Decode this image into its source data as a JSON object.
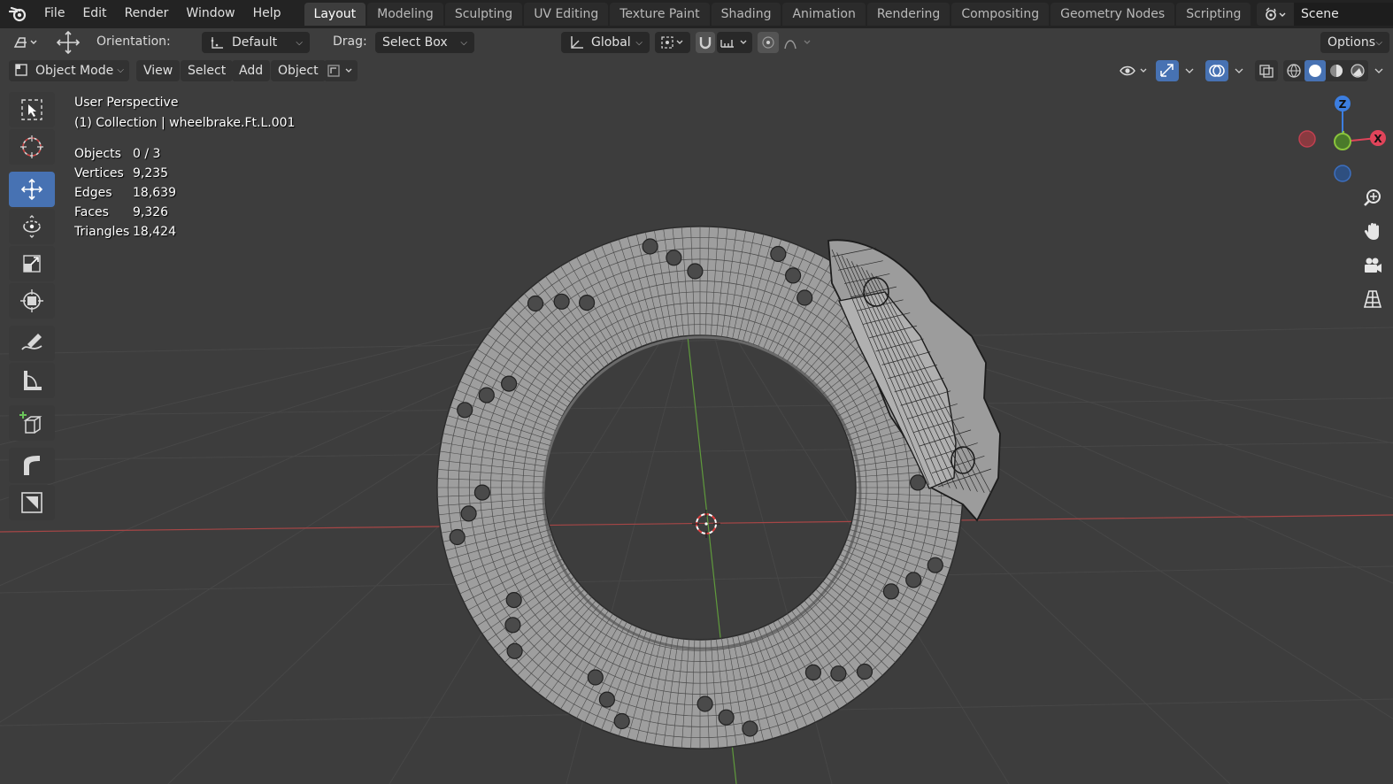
{
  "menu": {
    "items": [
      "File",
      "Edit",
      "Render",
      "Window",
      "Help"
    ]
  },
  "workspaces": {
    "tabs": [
      "Layout",
      "Modeling",
      "Sculpting",
      "UV Editing",
      "Texture Paint",
      "Shading",
      "Animation",
      "Rendering",
      "Compositing",
      "Geometry Nodes",
      "Scripting"
    ],
    "active": "Layout"
  },
  "scene": {
    "name": "Scene"
  },
  "toolheader": {
    "orientation_label": "Orientation:",
    "orientation_value": "Default",
    "drag_label": "Drag:",
    "drag_value": "Select Box",
    "transform_orientation": "Global",
    "options_label": "Options"
  },
  "viewport_header": {
    "mode": "Object Mode",
    "menus": [
      "View",
      "Select",
      "Add",
      "Object"
    ]
  },
  "overlay": {
    "perspective": "User Perspective",
    "collection": "(1) Collection | wheelbrake.Ft.L.001"
  },
  "stats": [
    {
      "label": "Objects",
      "value": "0 / 3"
    },
    {
      "label": "Vertices",
      "value": "9,235"
    },
    {
      "label": "Edges",
      "value": "18,639"
    },
    {
      "label": "Faces",
      "value": "9,326"
    },
    {
      "label": "Triangles",
      "value": "18,424"
    }
  ],
  "gizmo": {
    "z_label": "Z",
    "x_label": "X",
    "colors": {
      "x": "#e0445a",
      "y": "#8ac43c",
      "z": "#3c7ee0"
    }
  },
  "colors": {
    "accent": "#4772b3",
    "viewport_bg": "#3d3d3d",
    "mesh_fill": "#9c9c9c",
    "grid_x_axis": "#b04a4a",
    "grid_y_axis": "#6aa34a"
  },
  "toolbar_icons": [
    "select-box-icon",
    "cursor-icon",
    "move-icon",
    "rotate-icon",
    "scale-icon",
    "transform-icon",
    "annotate-icon",
    "measure-icon",
    "add-cube-icon",
    "shear-icon",
    "extrude-icon"
  ],
  "nav_icons": [
    "zoom-icon",
    "pan-hand-icon",
    "camera-icon",
    "grid-view-icon"
  ]
}
